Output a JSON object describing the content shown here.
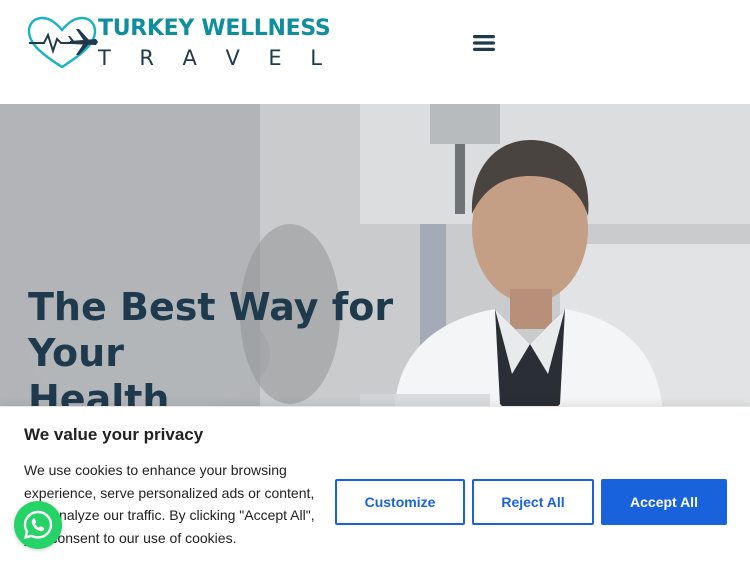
{
  "header": {
    "logo_line1": "TURKEY WELLNESS",
    "logo_line2_letters": [
      "T",
      "R",
      "A",
      "V",
      "E",
      "L"
    ],
    "menu_icon": "hamburger-menu-icon"
  },
  "hero": {
    "title_line1": "The Best Way for Your",
    "title_line2": "Health"
  },
  "cookie_banner": {
    "title": "We value your privacy",
    "text": "We use cookies to enhance your browsing experience, serve personalized ads or content, and analyze our traffic. By clicking \"Accept All\", you consent to our use of cookies.",
    "customize_label": "Customize",
    "reject_label": "Reject All",
    "accept_label": "Accept All"
  },
  "whatsapp": {
    "icon": "whatsapp-icon"
  },
  "colors": {
    "brand_teal": "#0e8f9b",
    "navy": "#1f3a4d",
    "button_blue": "#1863dc",
    "whatsapp_green": "#25d366"
  }
}
